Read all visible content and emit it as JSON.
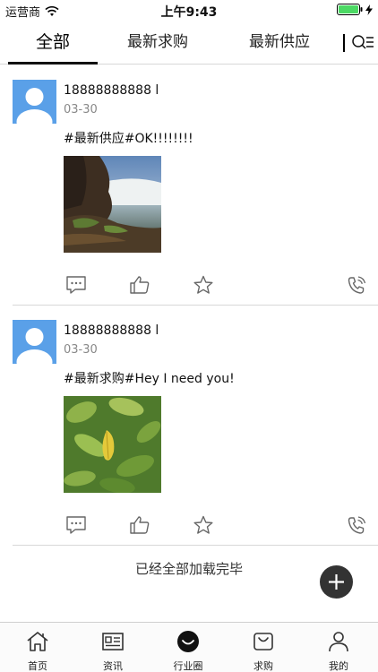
{
  "status_bar": {
    "carrier": "运营商",
    "time": "上午9:43"
  },
  "tabs": [
    {
      "label": "全部",
      "active": true
    },
    {
      "label": "最新求购",
      "active": false
    },
    {
      "label": "最新供应",
      "active": false
    }
  ],
  "posts": [
    {
      "username": "18888888888 l",
      "date": "03-30",
      "text": "#最新供应#OK!!!!!!!!",
      "image": "waterfall-photo"
    },
    {
      "username": "18888888888 l",
      "date": "03-30",
      "text": "#最新求购#Hey I need you!",
      "image": "leaves-photo"
    }
  ],
  "load_done_text": "已经全部加载完毕",
  "bottom_nav": [
    {
      "label": "首页",
      "icon": "home-icon"
    },
    {
      "label": "资讯",
      "icon": "news-icon"
    },
    {
      "label": "行业圈",
      "icon": "circle-icon",
      "active": true
    },
    {
      "label": "求购",
      "icon": "bag-icon"
    },
    {
      "label": "我的",
      "icon": "user-icon"
    }
  ],
  "colors": {
    "avatar_bg": "#5aa0e8",
    "fab_bg": "#333333",
    "battery": "#4cd964"
  }
}
